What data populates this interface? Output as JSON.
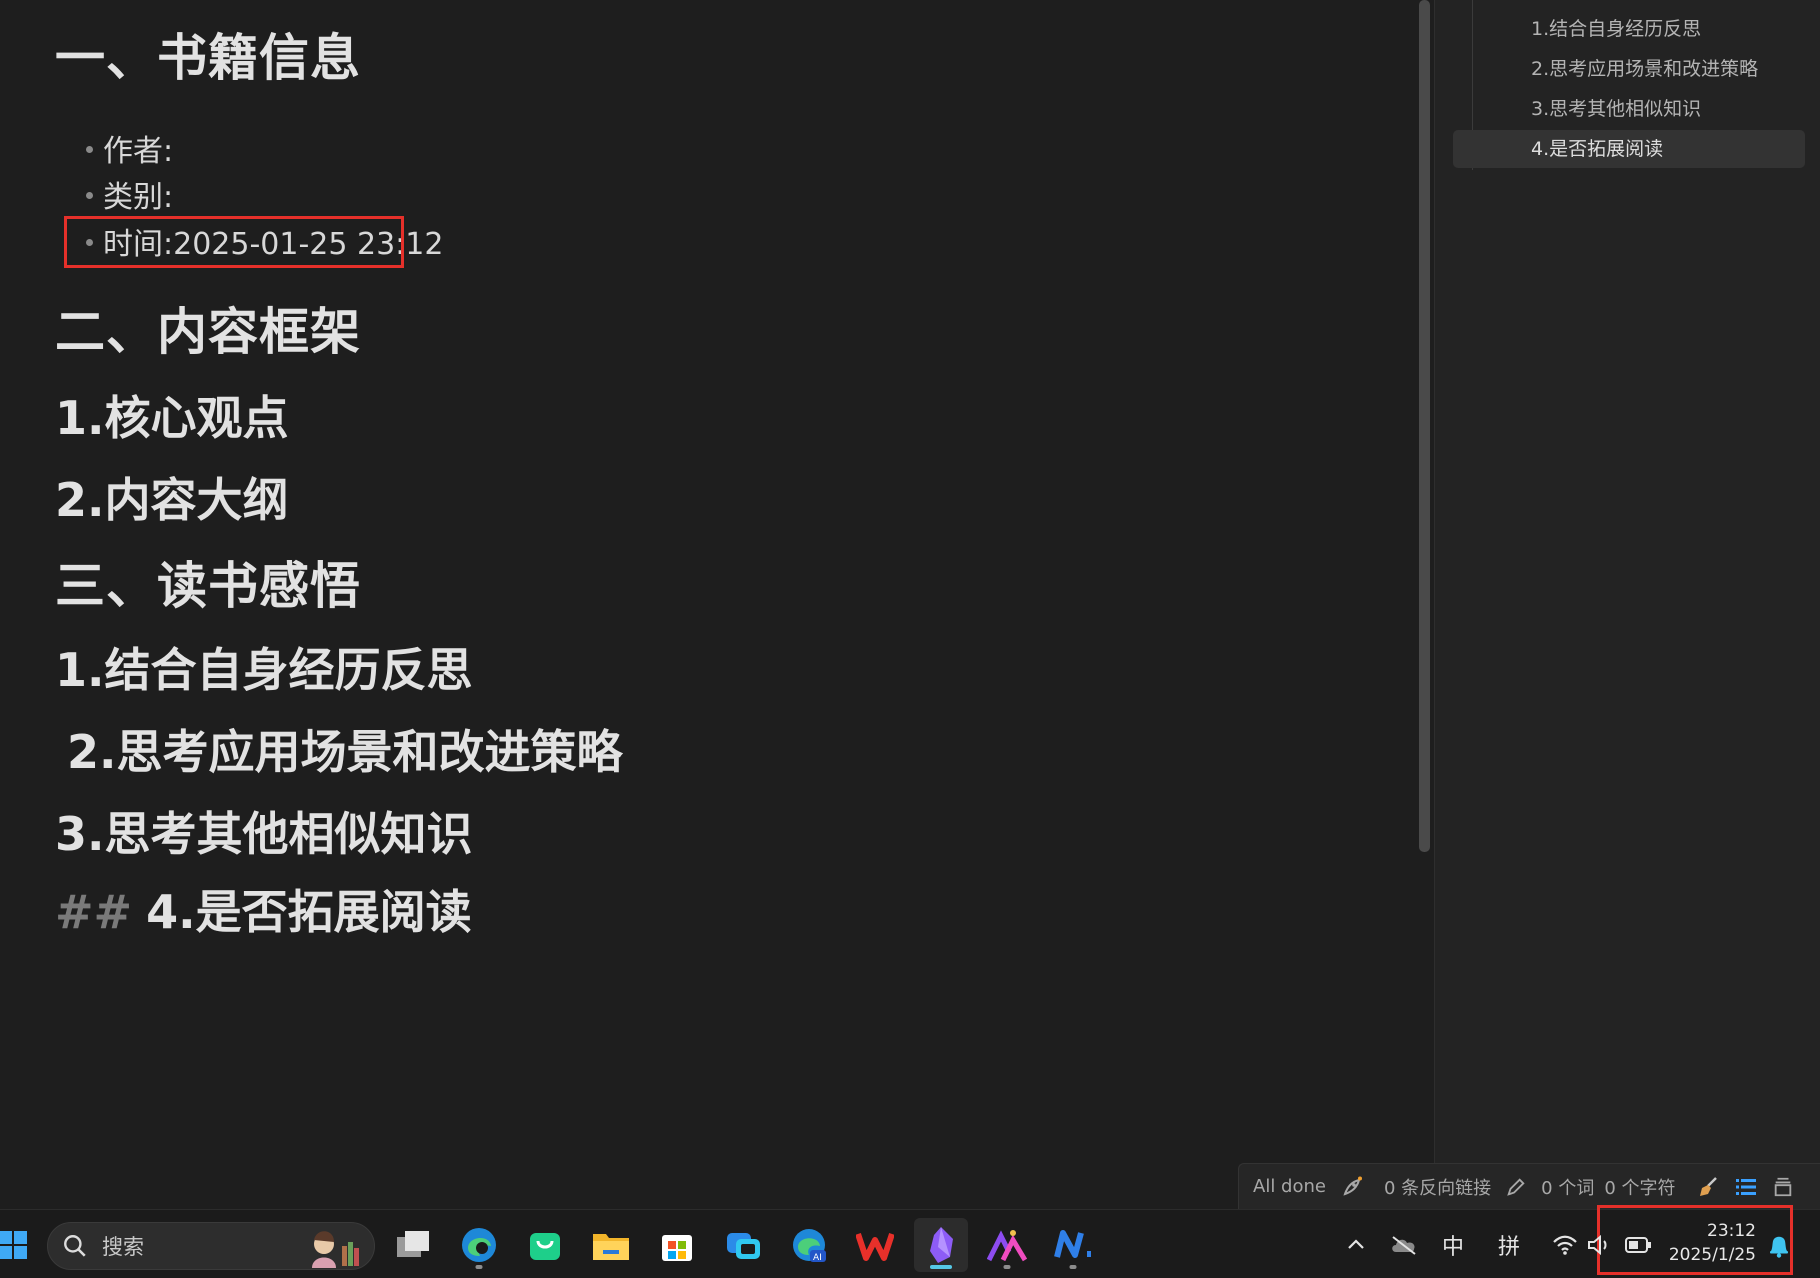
{
  "editor": {
    "heading1": "一、书籍信息",
    "bullets": [
      "作者:",
      "类别:",
      "时间:2025-01-25 23:12"
    ],
    "heading2": "二、内容框架",
    "sub1": "1.核心观点",
    "sub2": "2.内容大纲",
    "heading3": "三、读书感悟",
    "sub3": "1.结合自身经历反思",
    "sub4": "2.思考应用场景和改进策略",
    "sub5": "3.思考其他相似知识",
    "sub6_prefix": "##",
    "sub6": "4.是否拓展阅读"
  },
  "outline": {
    "items": [
      {
        "label": "1.结合自身经历反思",
        "active": false
      },
      {
        "label": "2.思考应用场景和改进策略",
        "active": false
      },
      {
        "label": "3.思考其他相似知识",
        "active": false
      },
      {
        "label": "4.是否拓展阅读",
        "active": true
      }
    ]
  },
  "statusbar": {
    "sync_status": "All done",
    "backlinks": "0 条反向链接",
    "words": "0 个词",
    "chars": "0 个字符"
  },
  "taskbar": {
    "search_placeholder": "搜索",
    "apps": [
      "start-icon",
      "task-view-icon",
      "edge-icon",
      "shopping-bag-icon",
      "file-explorer-icon",
      "store-icon",
      "phone-link-icon",
      "edge-ai-icon",
      "wps-icon",
      "obsidian-icon",
      "ai-app-icon",
      "notion-like-icon"
    ],
    "tray": {
      "ime_mode": "中",
      "ime_input": "拼"
    },
    "clock": {
      "time": "23:12",
      "date": "2025/1/25"
    }
  },
  "colors": {
    "background": "#1e1e1e",
    "highlight_box": "#e5302a",
    "accent": "#3aa0ff"
  }
}
